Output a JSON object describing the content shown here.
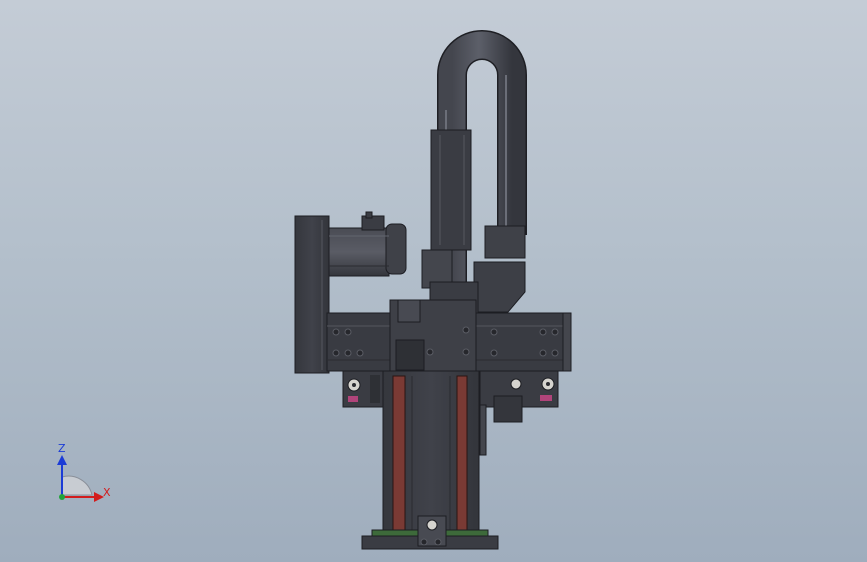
{
  "view": {
    "background_top": "#c4ccd6",
    "background_bottom": "#9fadbd"
  },
  "model": {
    "body_color": "#3b3d44",
    "edge_color": "#1c1d22",
    "accent_color": "#7a3a34",
    "base_color": "#3d6a3a",
    "pink_color": "#b0447a"
  },
  "triad": {
    "z_label": "Z",
    "x_label": "X",
    "z_color": "#1c3cd6",
    "x_color": "#d21c1c",
    "origin_color": "#1fa33a"
  }
}
